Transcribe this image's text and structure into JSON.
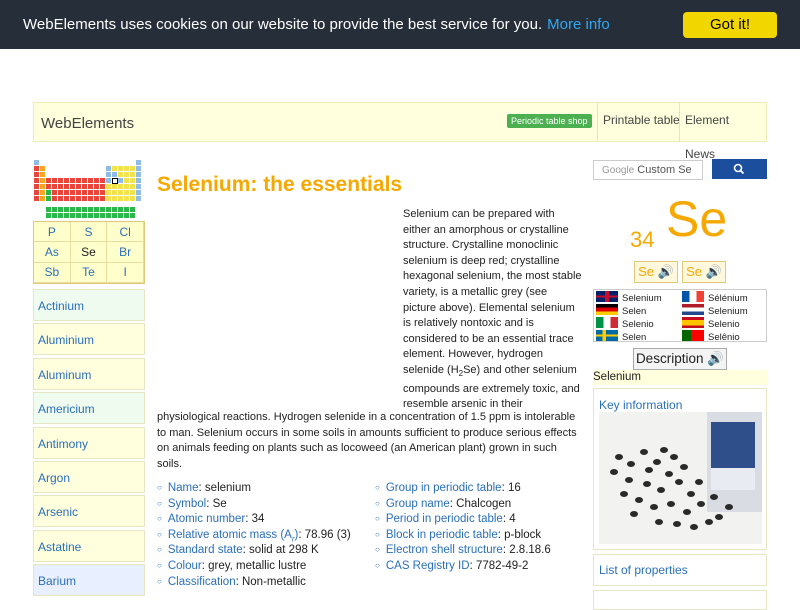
{
  "cookie": {
    "text": "WebElements uses cookies on our website to provide the best service for you.",
    "more_label": "More info",
    "button_label": "Got it!"
  },
  "header": {
    "brand": "WebElements",
    "shop_label": "Periodic table shop",
    "nav": [
      "Printable table",
      "Element News"
    ]
  },
  "element_grid": [
    [
      "P",
      "S",
      "Cl"
    ],
    [
      "As",
      "Se",
      "Br"
    ],
    [
      "Sb",
      "Te",
      "I"
    ]
  ],
  "sidebar": {
    "items": [
      "Actinium",
      "Aluminium",
      "Aluminum",
      "Americium",
      "Antimony",
      "Argon",
      "Arsenic",
      "Astatine",
      "Barium"
    ]
  },
  "page": {
    "title": "Selenium: the essentials",
    "para_right": "Selenium can be prepared with either an amorphous or crystalline structure. Crystalline monoclinic selenium is deep red; crystalline hexagonal selenium, the most stable variety, is a metallic grey (see picture above). Elemental selenium is relatively nontoxic and is considered to be an essential trace element. However, hydrogen selenide (H",
    "para_right_sub": "2",
    "para_right_tail": "Se) and other selenium compounds are extremely toxic, and resemble arsenic in their",
    "para_full": "physiological reactions. Hydrogen selenide in a concentration of 1.5 ppm is intolerable to man. Selenium occurs in some soils in amounts sufficient to produce serious effects on animals feeding on plants such as locoweed (an American plant) grown in such soils."
  },
  "facts_left": [
    {
      "k": "Name",
      "v": ": selenium"
    },
    {
      "k": "Symbol",
      "v": ": Se"
    },
    {
      "k": "Atomic number",
      "v": ": 34"
    },
    {
      "k": "Relative atomic mass (A",
      "sub": "r",
      "k2": ")",
      "v": ": 78.96 (3)"
    },
    {
      "k": "Standard state",
      "v": ": solid at 298 K"
    },
    {
      "k": "Colour",
      "v": ": grey, metallic lustre"
    },
    {
      "k": "Classification",
      "v": ": Non-metallic"
    }
  ],
  "facts_right": [
    {
      "k": "Group in periodic table",
      "v": ": 16"
    },
    {
      "k": "Group name",
      "v": ": Chalcogen"
    },
    {
      "k": "Period in periodic table",
      "v": ": 4"
    },
    {
      "k": "Block in periodic table",
      "v": ": p-block"
    },
    {
      "k": "Electron shell structure",
      "v": ": 2.8.18.6"
    },
    {
      "k": "CAS Registry ID",
      "v": ": 7782-49-2"
    }
  ],
  "search": {
    "google_label": "Google",
    "placeholder": "Custom Se"
  },
  "symbol_box": {
    "number": "34",
    "symbol": "Se",
    "speaker_labels": [
      "Se",
      "Se"
    ]
  },
  "languages": [
    {
      "flag": "uk-flag",
      "name": "Selenium"
    },
    {
      "flag": "france-flag",
      "name": "Sélénium"
    },
    {
      "flag": "germany-flag",
      "name": "Selen"
    },
    {
      "flag": "netherlands-flag",
      "name": "Selenium"
    },
    {
      "flag": "italy-flag",
      "name": "Selenio"
    },
    {
      "flag": "spain-flag",
      "name": "Selenio"
    },
    {
      "flag": "sweden-flag",
      "name": "Selen"
    },
    {
      "flag": "portugal-flag",
      "name": "Selênio"
    }
  ],
  "description_label": "Description",
  "element_name": "Selenium",
  "key_info_label": "Key information",
  "list_props_label": "List of properties",
  "colors": {
    "accent_orange": "#f5a800",
    "link_blue": "#2a6fba",
    "cookie_bg": "#252e39",
    "cookie_button": "#f1d600",
    "shop_green": "#4caf50"
  }
}
